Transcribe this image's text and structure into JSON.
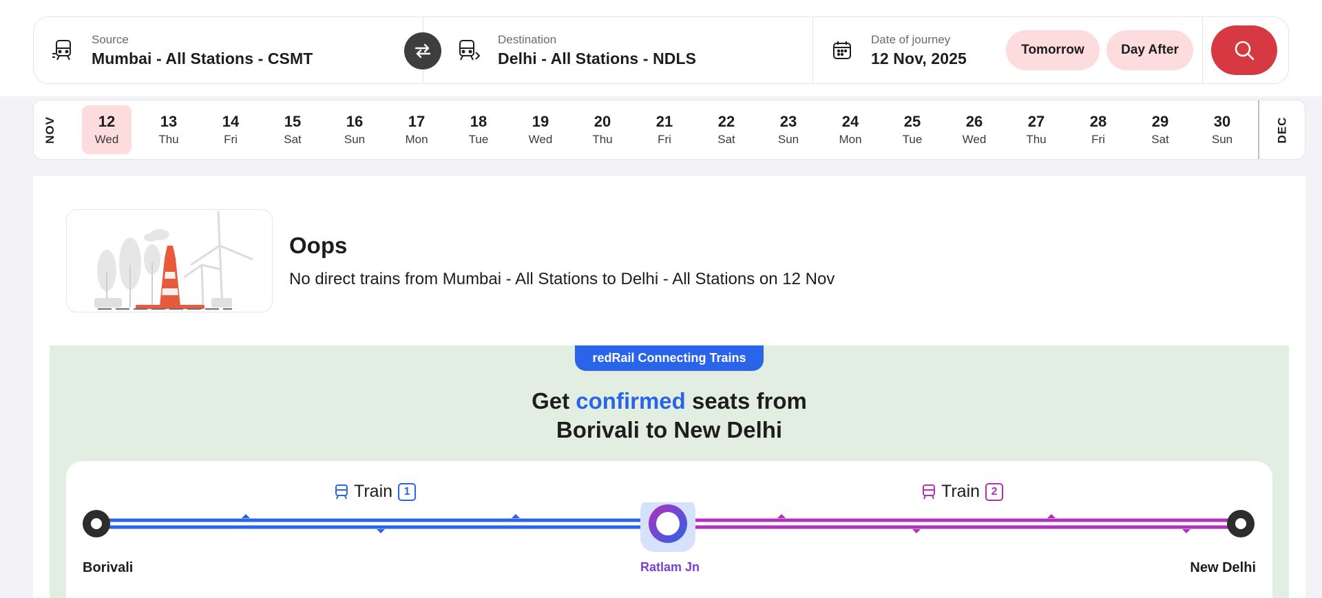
{
  "search": {
    "source_label": "Source",
    "source_value": "Mumbai - All Stations - CSMT",
    "destination_label": "Destination",
    "destination_value": "Delhi - All Stations - NDLS",
    "date_label": "Date of journey",
    "date_value": "12 Nov, 2025",
    "tomorrow_label": "Tomorrow",
    "day_after_label": "Day After",
    "icons": {
      "source": "train-depart-icon",
      "destination": "train-arrive-icon",
      "date": "calendar-icon",
      "swap": "swap-arrows-icon",
      "search": "search-icon"
    }
  },
  "date_strip": {
    "month_start": "NOV",
    "month_end": "DEC",
    "selected": "12",
    "days": [
      {
        "num": "12",
        "dow": "Wed"
      },
      {
        "num": "13",
        "dow": "Thu"
      },
      {
        "num": "14",
        "dow": "Fri"
      },
      {
        "num": "15",
        "dow": "Sat"
      },
      {
        "num": "16",
        "dow": "Sun"
      },
      {
        "num": "17",
        "dow": "Mon"
      },
      {
        "num": "18",
        "dow": "Tue"
      },
      {
        "num": "19",
        "dow": "Wed"
      },
      {
        "num": "20",
        "dow": "Thu"
      },
      {
        "num": "21",
        "dow": "Fri"
      },
      {
        "num": "22",
        "dow": "Sat"
      },
      {
        "num": "23",
        "dow": "Sun"
      },
      {
        "num": "24",
        "dow": "Mon"
      },
      {
        "num": "25",
        "dow": "Tue"
      },
      {
        "num": "26",
        "dow": "Wed"
      },
      {
        "num": "27",
        "dow": "Thu"
      },
      {
        "num": "28",
        "dow": "Fri"
      },
      {
        "num": "29",
        "dow": "Sat"
      },
      {
        "num": "30",
        "dow": "Sun"
      }
    ]
  },
  "notice": {
    "title": "Oops",
    "message": "No direct trains from Mumbai - All Stations to Delhi - All Stations on 12 Nov"
  },
  "connecting": {
    "badge": "redRail Connecting Trains",
    "title_pre": "Get ",
    "title_highlight": "confirmed",
    "title_post": " seats from",
    "title_line2": "Borivali to New Delhi",
    "train_word": "Train",
    "train1_number": "1",
    "train2_number": "2",
    "station_start": "Borivali",
    "station_mid": "Ratlam Jn",
    "station_end": "New Delhi"
  },
  "colors": {
    "brand_red": "#d63941",
    "chip_bg": "#fcdcdc",
    "train1": "#2a64e8",
    "train2": "#b32fbd",
    "connect_bg": "#e3eee3"
  }
}
